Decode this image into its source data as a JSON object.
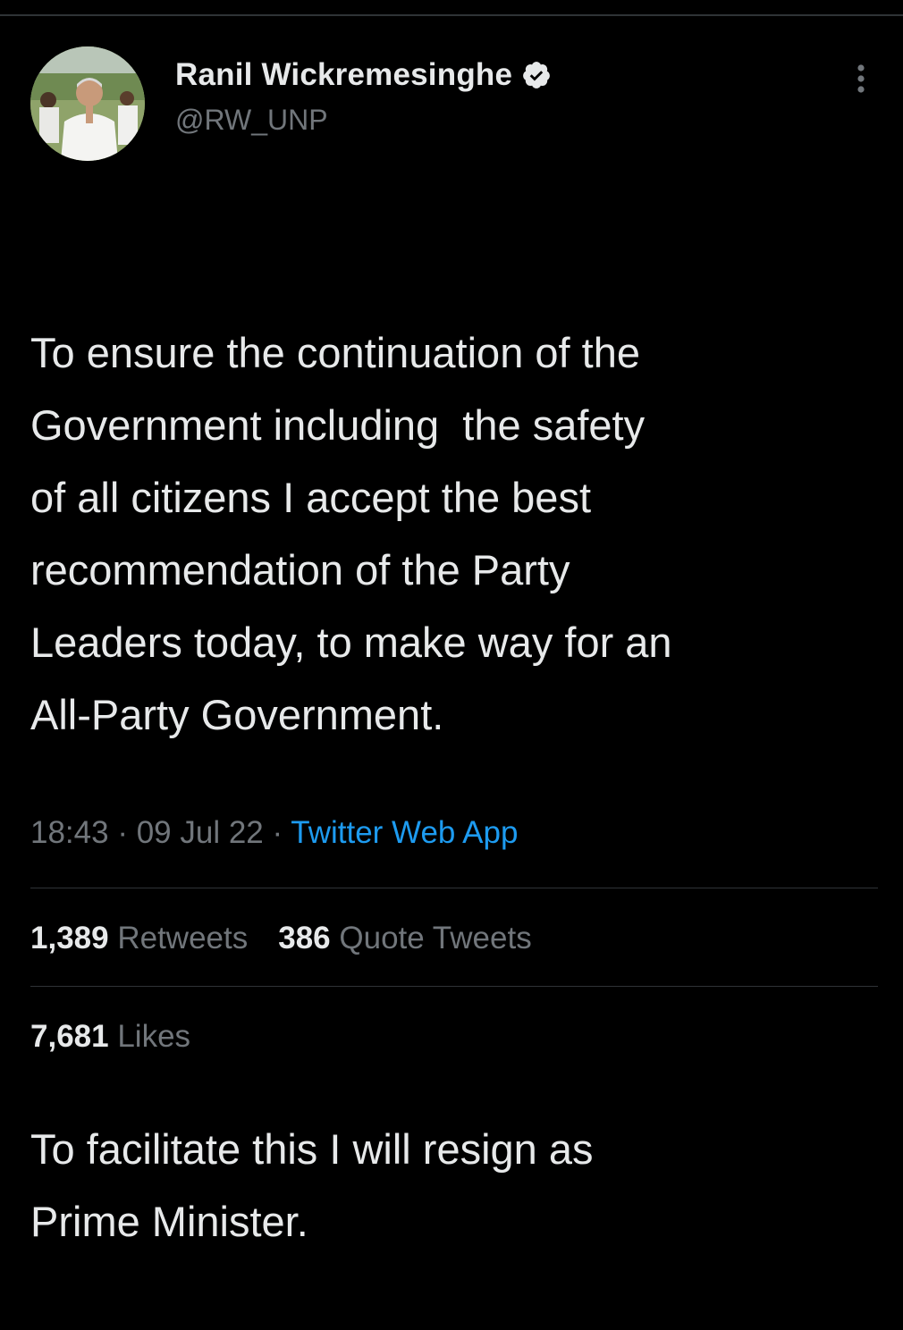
{
  "author": {
    "display_name": "Ranil Wickremesinghe",
    "handle": "@RW_UNP",
    "verified_icon": "verified-badge-icon",
    "avatar_icon": "profile-photo"
  },
  "menu": {
    "more_icon": "more-options-icon"
  },
  "tweet": {
    "paragraphs": [
      "To ensure the continuation of the\nGovernment including  the safety\nof all citizens I accept the best\nrecommendation of the Party\nLeaders today, to make way for an\nAll-Party Government.",
      "To facilitate this I will resign as\nPrime Minister."
    ]
  },
  "meta": {
    "time": "18:43",
    "separator": " · ",
    "date": "09 Jul 22",
    "source": "Twitter Web App"
  },
  "stats": {
    "retweets_count": "1,389",
    "retweets_label": "Retweets",
    "quotes_count": "386",
    "quotes_label": "Quote Tweets",
    "likes_count": "7,681",
    "likes_label": "Likes"
  },
  "colors": {
    "background": "#000000",
    "text_primary": "#e7e9ea",
    "text_secondary": "#71767b",
    "link": "#1d9bf0",
    "divider": "#2f3336"
  }
}
